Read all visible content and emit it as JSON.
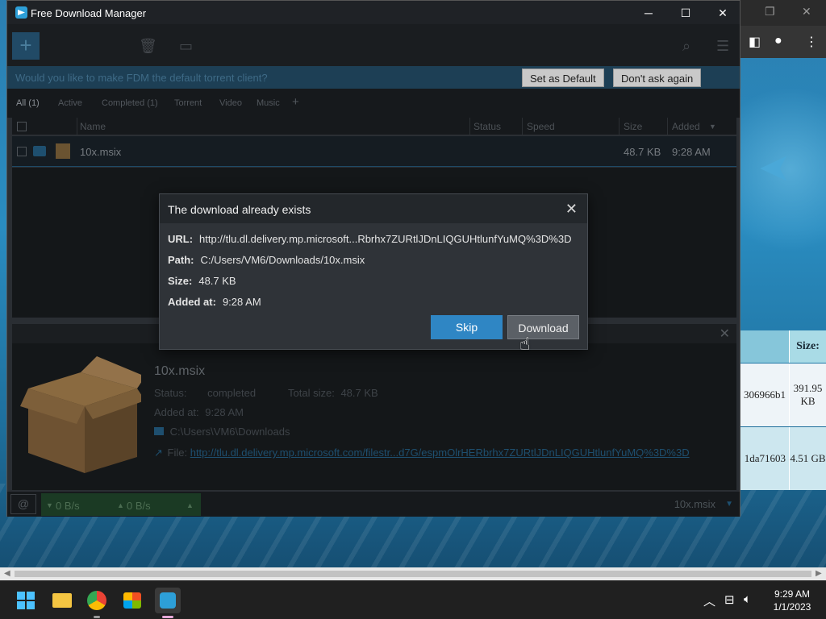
{
  "window": {
    "title": "Free Download Manager",
    "minimize": "─",
    "maximize": "☐",
    "close": "✕"
  },
  "banner": {
    "text": "Would you like to make FDM the default torrent client?",
    "set_default": "Set as Default",
    "dont_ask": "Don't ask again"
  },
  "tabs": [
    {
      "label": "All (1)"
    },
    {
      "label": "Active"
    },
    {
      "label": "Completed (1)"
    },
    {
      "label": "Torrent"
    },
    {
      "label": "Video"
    },
    {
      "label": "Music"
    },
    {
      "label": "+"
    }
  ],
  "columns": {
    "name": "Name",
    "status": "Status",
    "speed": "Speed",
    "size": "Size",
    "added": "Added"
  },
  "downloads": [
    {
      "name": "10x.msix",
      "size": "48.7 KB",
      "added": "9:28 AM"
    }
  ],
  "details": {
    "name": "10x.msix",
    "status_label": "Status:",
    "status_value": "completed",
    "total_size_label": "Total size:",
    "total_size_value": "48.7 KB",
    "added_label": "Added at:",
    "added_value": "9:28 AM",
    "folder": "C:\\Users\\VM6\\Downloads",
    "file_label": "File:",
    "file_link": "http://tlu.dl.delivery.mp.microsoft.com/filestr...d7G/espmOlrHERbrhx7ZURtlJDnLIQGUHtlunfYuMQ%3D%3D"
  },
  "statusbar": {
    "down": "0 B/s",
    "up": "0 B/s",
    "current_file": "10x.msix"
  },
  "dialog": {
    "title": "The download already exists",
    "url_label": "URL:",
    "url_value": "http://tlu.dl.delivery.mp.microsoft...Rbrhx7ZURtlJDnLIQGUHtlunfYuMQ%3D%3D",
    "path_label": "Path:",
    "path_value": "C:/Users/VM6/Downloads/10x.msix",
    "size_label": "Size:",
    "size_value": "48.7 KB",
    "added_label": "Added at:",
    "added_value": "9:28 AM",
    "skip": "Skip",
    "download": "Download"
  },
  "background_page": {
    "size_header": "Size:",
    "row1_hash": "306966b1",
    "row1_size": "391.95 KB",
    "row2_hash": "1da71603",
    "row2_size": "4.51 GB"
  },
  "taskbar": {
    "time": "9:29 AM",
    "date": "1/1/2023"
  },
  "colors": {
    "accent": "#2f86c4",
    "window_bg": "#2a2e33",
    "dialog_bg": "#2f3338"
  }
}
